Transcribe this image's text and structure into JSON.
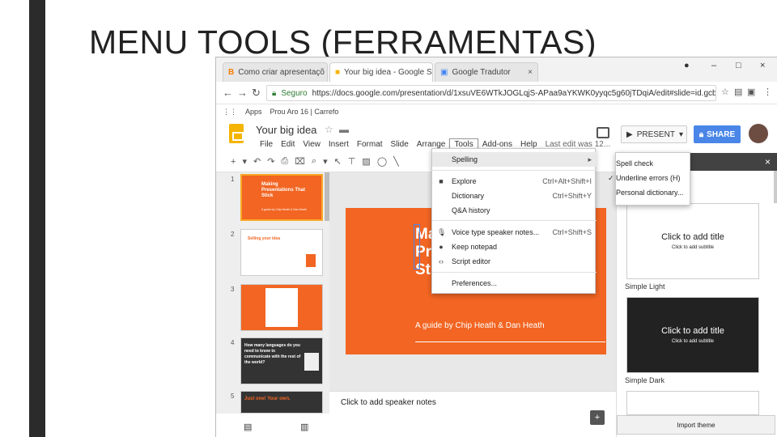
{
  "slide": {
    "title": "MENU TOOLS (FERRAMENTAS)"
  },
  "browser": {
    "tabs": [
      {
        "label": "Como criar apresentaçõ",
        "icon": "blogger-icon"
      },
      {
        "label": "Your big idea - Google S",
        "icon": "slides-icon"
      },
      {
        "label": "Google Tradutor",
        "icon": "translate-icon"
      }
    ],
    "controls": {
      "minimize": "–",
      "maximize": "□",
      "close": "×"
    },
    "url_secure_label": "Seguro",
    "url": "https://docs.google.com/presentation/d/1xsuVE6WTkJOGLqjS-APaa9aYKWK0yyqc5g60jTDqiA/edit#slide=id.gcb9...",
    "bookmarks": [
      "Apps",
      "Prou Aro 16 | Carrefo"
    ]
  },
  "app": {
    "doc_title": "Your big idea",
    "menus": [
      "File",
      "Edit",
      "View",
      "Insert",
      "Format",
      "Slide",
      "Arrange",
      "Tools",
      "Add-ons",
      "Help"
    ],
    "last_edit": "Last edit was 12...",
    "present_label": "PRESENT",
    "share_label": "SHARE"
  },
  "tools_menu": {
    "items": [
      {
        "label": "Spelling",
        "shortcut": "▸",
        "icon": ""
      },
      {
        "label": "Explore",
        "shortcut": "Ctrl+Alt+Shift+I",
        "icon": "explore-icon"
      },
      {
        "label": "Dictionary",
        "shortcut": "Ctrl+Shift+Y",
        "icon": ""
      },
      {
        "label": "Q&A history",
        "shortcut": "",
        "icon": ""
      },
      {
        "label": "Voice type speaker notes...",
        "shortcut": "Ctrl+Shift+S",
        "icon": "mic-icon"
      },
      {
        "label": "Keep notepad",
        "shortcut": "",
        "icon": "bulb-icon"
      },
      {
        "label": "Script editor",
        "shortcut": "",
        "icon": "code-icon"
      },
      {
        "label": "Preferences...",
        "shortcut": "",
        "icon": ""
      }
    ]
  },
  "spelling_submenu": {
    "items": [
      "Spell check",
      "Underline errors (H)",
      "Personal dictionary..."
    ],
    "checked": "Underline errors (H)"
  },
  "filmstrip": {
    "numbers": [
      "1",
      "2",
      "3",
      "4",
      "5"
    ],
    "thumb1": {
      "title": "Making Presentations That Stick",
      "sub": "A guide by Chip Heath & Dan Heath"
    },
    "thumb2": {
      "title": "Selling your idea"
    },
    "thumb4": {
      "title": "How many languages do you need to know to communicate with the rest of the world?"
    },
    "thumb5": {
      "title": "Just one! Your own."
    }
  },
  "main_slide": {
    "title_partial": "Ma\nPr\nSt",
    "subtitle": "A guide by Chip Heath & Dan Heath",
    "color": "#f26522"
  },
  "notes": {
    "placeholder": "Click to add speaker notes"
  },
  "themes": {
    "close": "×",
    "cards": [
      {
        "title": "Click to add title",
        "subtitle": "Click to add subtitle",
        "name": "Simple Light"
      },
      {
        "title": "Click to add title",
        "subtitle": "Click to add subtitle",
        "name": "Simple Dark"
      }
    ],
    "import_label": "Import theme"
  }
}
